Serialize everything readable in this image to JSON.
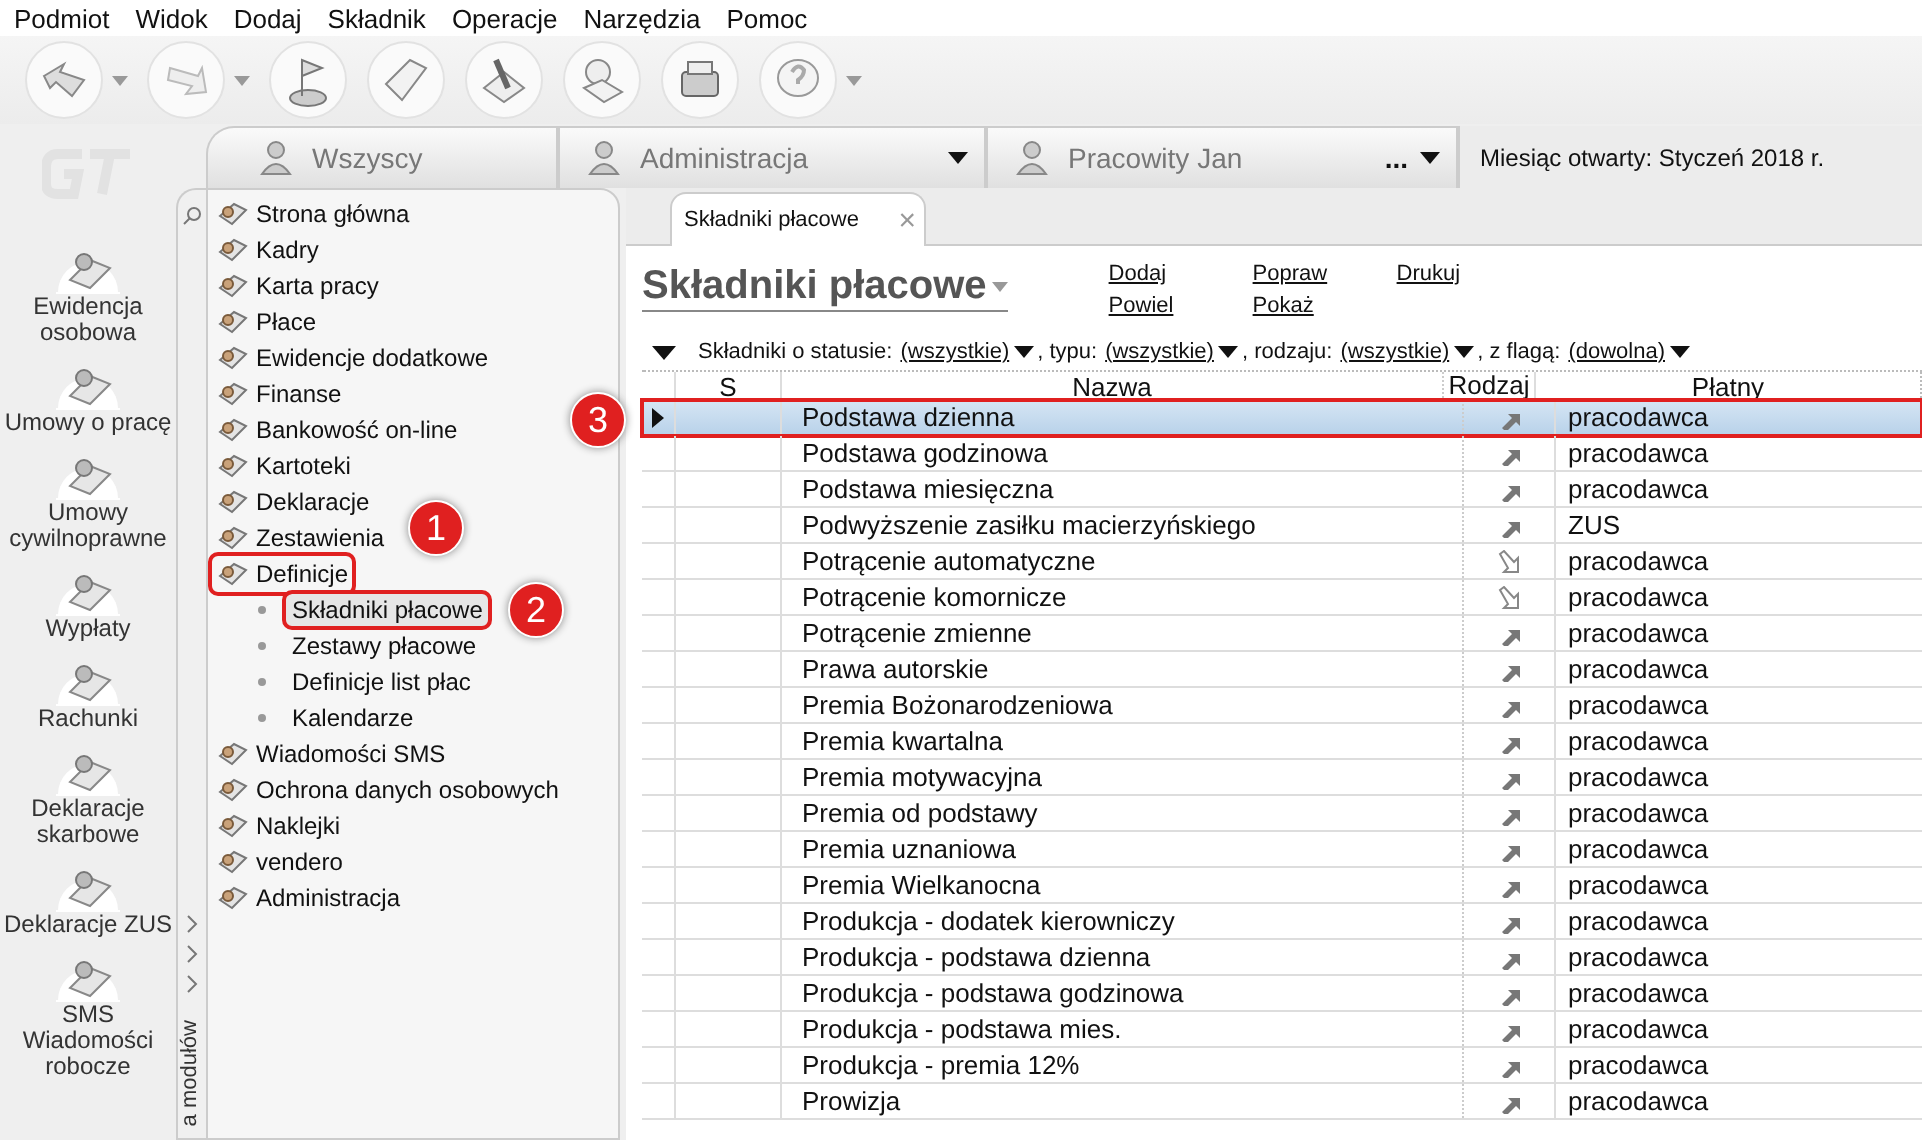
{
  "menu": [
    "Podmiot",
    "Widok",
    "Dodaj",
    "Składnik",
    "Operacje",
    "Narzędzia",
    "Pomoc"
  ],
  "toolbar": [
    {
      "dropdown": true
    },
    {
      "dropdown": true
    },
    {
      "dropdown": false
    },
    {
      "dropdown": false
    },
    {
      "dropdown": false
    },
    {
      "dropdown": false
    },
    {
      "dropdown": false
    },
    {
      "dropdown": true
    }
  ],
  "top_tabs": [
    {
      "label": "Wszyscy",
      "dropdown": false
    },
    {
      "label": "Administracja",
      "dropdown": true
    },
    {
      "label": "Pracowity Jan",
      "dropdown": true,
      "extra": "..."
    }
  ],
  "open_month": {
    "label": "Miesiąc otwarty:",
    "value": "Styczeń 2018 r."
  },
  "modules": [
    {
      "label": "Ewidencja\nosobowa"
    },
    {
      "label": "Umowy o pracę"
    },
    {
      "label": "Umowy\ncywilnoprawne"
    },
    {
      "label": "Wypłaty"
    },
    {
      "label": "Rachunki"
    },
    {
      "label": "Deklaracje\nskarbowe"
    },
    {
      "label": "Deklaracje ZUS"
    },
    {
      "label": "SMS\nWiadomości\nrobocze"
    }
  ],
  "module_strip": {
    "label": "a modułów"
  },
  "nav": [
    {
      "label": "Strona główna",
      "outlined": false
    },
    {
      "label": "Kadry",
      "outlined": false
    },
    {
      "label": "Karta pracy",
      "outlined": false
    },
    {
      "label": "Płace",
      "outlined": false
    },
    {
      "label": "Ewidencje dodatkowe",
      "outlined": false
    },
    {
      "label": "Finanse",
      "outlined": false
    },
    {
      "label": "Bankowość on-line",
      "outlined": false
    },
    {
      "label": "Kartoteki",
      "outlined": false
    },
    {
      "label": "Deklaracje",
      "outlined": false
    },
    {
      "label": "Zestawienia",
      "outlined": false
    },
    {
      "label": "Definicje",
      "outlined": true,
      "callout": "1",
      "children": [
        {
          "label": "Składniki płacowe",
          "selected": true,
          "outlined": true,
          "callout": "2"
        },
        {
          "label": "Zestawy płacowe",
          "selected": false,
          "outlined": false
        },
        {
          "label": "Definicje list płac",
          "selected": false,
          "outlined": false
        },
        {
          "label": "Kalendarze",
          "selected": false,
          "outlined": false
        }
      ]
    },
    {
      "label": "Wiadomości SMS",
      "outlined": false
    },
    {
      "label": "Ochrona danych osobowych",
      "outlined": false
    },
    {
      "label": "Naklejki",
      "outlined": false
    },
    {
      "label": "vendero",
      "outlined": false
    },
    {
      "label": "Administracja",
      "outlined": false
    }
  ],
  "doc_tab": {
    "label": "Składniki płacowe",
    "close": "×"
  },
  "title": "Składniki płacowe",
  "actions": [
    [
      "Dodaj",
      "Powiel"
    ],
    [
      "Popraw",
      "Pokaż"
    ],
    [
      "Drukuj"
    ]
  ],
  "filters": [
    {
      "label": "Składniki o statusie:",
      "value": "(wszystkie)"
    },
    {
      "label": ", typu:",
      "value": "(wszystkie)"
    },
    {
      "label": ", rodzaju:",
      "value": "(wszystkie)"
    },
    {
      "label": ", z flagą:",
      "value": "(dowolna)"
    }
  ],
  "table": {
    "columns": [
      "S",
      "Nazwa",
      "Rodzaj",
      "Płatny"
    ],
    "rows": [
      {
        "name": "Podstawa dzienna",
        "kind": "in",
        "payer": "pracodawca",
        "selected": true,
        "outlined": true,
        "callout": "3"
      },
      {
        "name": "Podstawa godzinowa",
        "kind": "in",
        "payer": "pracodawca",
        "selected": false,
        "outlined": false
      },
      {
        "name": "Podstawa miesięczna",
        "kind": "in",
        "payer": "pracodawca",
        "selected": false,
        "outlined": false
      },
      {
        "name": "Podwyższenie zasiłku macierzyńskiego",
        "kind": "in",
        "payer": "ZUS",
        "selected": false,
        "outlined": false
      },
      {
        "name": "Potrącenie automatyczne",
        "kind": "out",
        "payer": "pracodawca",
        "selected": false,
        "outlined": false
      },
      {
        "name": "Potrącenie komornicze",
        "kind": "out",
        "payer": "pracodawca",
        "selected": false,
        "outlined": false
      },
      {
        "name": "Potrącenie zmienne",
        "kind": "in",
        "payer": "pracodawca",
        "selected": false,
        "outlined": false
      },
      {
        "name": "Prawa autorskie",
        "kind": "in",
        "payer": "pracodawca",
        "selected": false,
        "outlined": false
      },
      {
        "name": "Premia Bożonarodzeniowa",
        "kind": "in",
        "payer": "pracodawca",
        "selected": false,
        "outlined": false
      },
      {
        "name": "Premia kwartalna",
        "kind": "in",
        "payer": "pracodawca",
        "selected": false,
        "outlined": false
      },
      {
        "name": "Premia motywacyjna",
        "kind": "in",
        "payer": "pracodawca",
        "selected": false,
        "outlined": false
      },
      {
        "name": "Premia od podstawy",
        "kind": "in",
        "payer": "pracodawca",
        "selected": false,
        "outlined": false
      },
      {
        "name": "Premia uznaniowa",
        "kind": "in",
        "payer": "pracodawca",
        "selected": false,
        "outlined": false
      },
      {
        "name": "Premia Wielkanocna",
        "kind": "in",
        "payer": "pracodawca",
        "selected": false,
        "outlined": false
      },
      {
        "name": "Produkcja - dodatek kierowniczy",
        "kind": "in",
        "payer": "pracodawca",
        "selected": false,
        "outlined": false
      },
      {
        "name": "Produkcja - podstawa dzienna",
        "kind": "in",
        "payer": "pracodawca",
        "selected": false,
        "outlined": false
      },
      {
        "name": "Produkcja - podstawa godzinowa",
        "kind": "in",
        "payer": "pracodawca",
        "selected": false,
        "outlined": false
      },
      {
        "name": "Produkcja - podstawa mies.",
        "kind": "in",
        "payer": "pracodawca",
        "selected": false,
        "outlined": false
      },
      {
        "name": "Produkcja - premia 12%",
        "kind": "in",
        "payer": "pracodawca",
        "selected": false,
        "outlined": false
      },
      {
        "name": "Prowizja",
        "kind": "in",
        "payer": "pracodawca",
        "selected": false,
        "outlined": false
      }
    ]
  }
}
